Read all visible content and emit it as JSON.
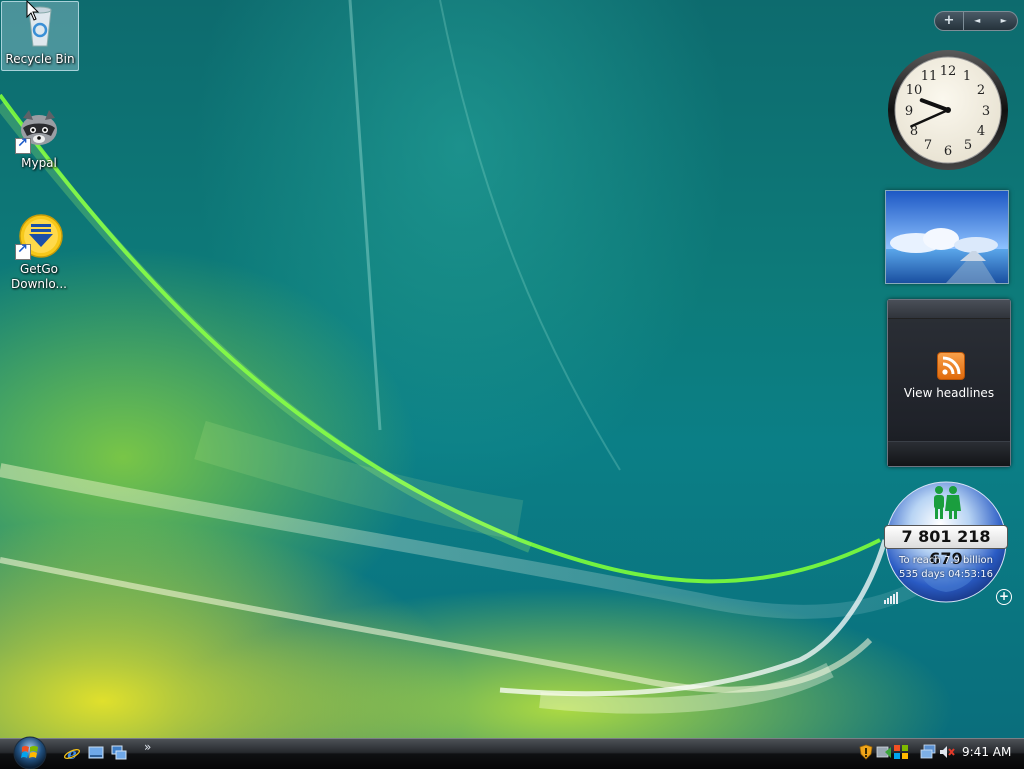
{
  "desktop": {
    "icons": [
      {
        "label": "Recycle Bin",
        "icon": "recycle-bin-icon"
      },
      {
        "label": "Mypal",
        "icon": "mypal-raccoon-icon"
      },
      {
        "label_line1": "GetGo",
        "label_line2": "Downlo...",
        "icon": "download-arrow-icon"
      }
    ]
  },
  "sidebar": {
    "controls": {
      "add": "+",
      "prev": "◄",
      "next": "►"
    },
    "clock": {
      "hour": 9,
      "minute": 41
    },
    "feed": {
      "label": "View headlines"
    },
    "worldpop": {
      "counter": "7 801 218 679",
      "line1": "To reach 7.9 billion",
      "line2": "535 days 04:53:16"
    }
  },
  "taskbar": {
    "quick_launch": [
      "internet-explorer-icon",
      "show-desktop-icon",
      "switch-windows-icon"
    ],
    "chevron": "»",
    "tray": [
      "security-shield-icon",
      "windows-defender-icon",
      "windows-flag-icon",
      "network-icon",
      "volume-muted-icon"
    ],
    "time": "9:41 AM"
  },
  "colors": {
    "accent": "#0b6f77",
    "rss": "#f08a28",
    "taskbar": "#111215"
  }
}
